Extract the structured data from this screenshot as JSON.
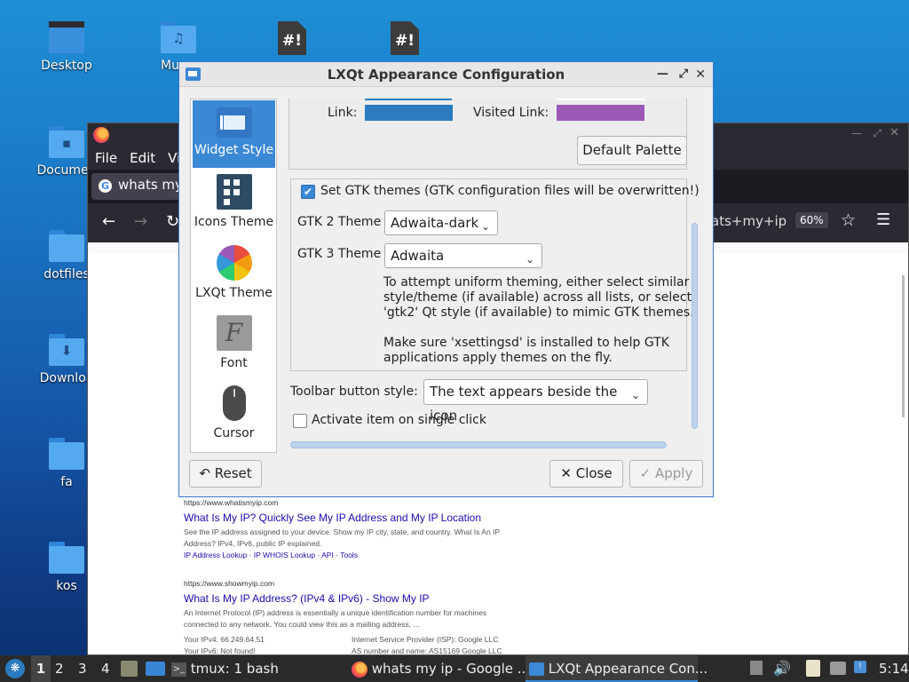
{
  "desktop": {
    "icons": [
      {
        "label": "Desktop"
      },
      {
        "label": "Mu"
      },
      {
        "label": "Documen"
      },
      {
        "label": "dotfiles"
      },
      {
        "label": "Downloa"
      },
      {
        "label": "fa"
      },
      {
        "label": "kos"
      }
    ],
    "script_glyph": "#!"
  },
  "firefox": {
    "menu": [
      "File",
      "Edit",
      "Vi"
    ],
    "tab_title": "whats my",
    "url_fragment": "ats+my+ip",
    "zoom": "60%",
    "results": [
      {
        "url": "https://www.whatismyip.com",
        "title": "What Is My IP? Quickly See My IP Address and My IP Location",
        "desc1": "See the IP address assigned to your device. Show my IP city, state, and country. What Is An IP",
        "desc2": "Address? IPv4, IPv6, public IP explained.",
        "links": "IP Address Lookup · IP WHOIS Lookup · API · Tools"
      },
      {
        "url": "https://www.showmyip.com",
        "title": "What Is My IP Address? (IPv4 & IPv6) - Show My IP",
        "desc1": "An Internet Protocol (IP) address is essentially a unique identification number for machines",
        "desc2": "connected to any network. You could view this as a mailing address, ...",
        "info": [
          "Your IPv4: 66.249.64.51",
          "Internet Service Provider (ISP): Google LLC",
          "Your IPv6: Not found!",
          "AS number and name: AS15169 Google LLC"
        ]
      }
    ]
  },
  "dialog": {
    "title": "LXQt Appearance Configuration",
    "sidebar": [
      "Widget Style",
      "Icons Theme",
      "LXQt Theme",
      "Font",
      "Cursor"
    ],
    "link_label": "Link:",
    "visited_link_label": "Visited Link:",
    "link_color": "#2a7bc0",
    "visited_color": "#9b59b6",
    "default_palette": "Default Palette",
    "gtk_checkbox": "Set GTK themes (GTK configuration files will be overwritten!)",
    "gtk2_label": "GTK 2 Theme",
    "gtk2_value": "Adwaita-dark",
    "gtk3_label": "GTK 3 Theme",
    "gtk3_value": "Adwaita",
    "note1": "To attempt uniform theming, either select similar",
    "note2": "style/theme (if available) across all lists, or select",
    "note3": "'gtk2' Qt style (if available) to mimic GTK themes.",
    "note4": "Make sure 'xsettingsd' is installed to help GTK",
    "note5": "applications apply themes on the fly.",
    "toolbar_label": "Toolbar button style:",
    "toolbar_value": "The text appears beside the icon",
    "single_click": "Activate item on single click",
    "reset": "Reset",
    "close": "Close",
    "apply": "Apply"
  },
  "taskbar": {
    "workspaces": [
      "1",
      "2",
      "3",
      "4"
    ],
    "tasks": [
      "tmux: 1 bash",
      "whats my ip - Google ...",
      "LXQt Appearance Con..."
    ],
    "clock": "5:14"
  }
}
